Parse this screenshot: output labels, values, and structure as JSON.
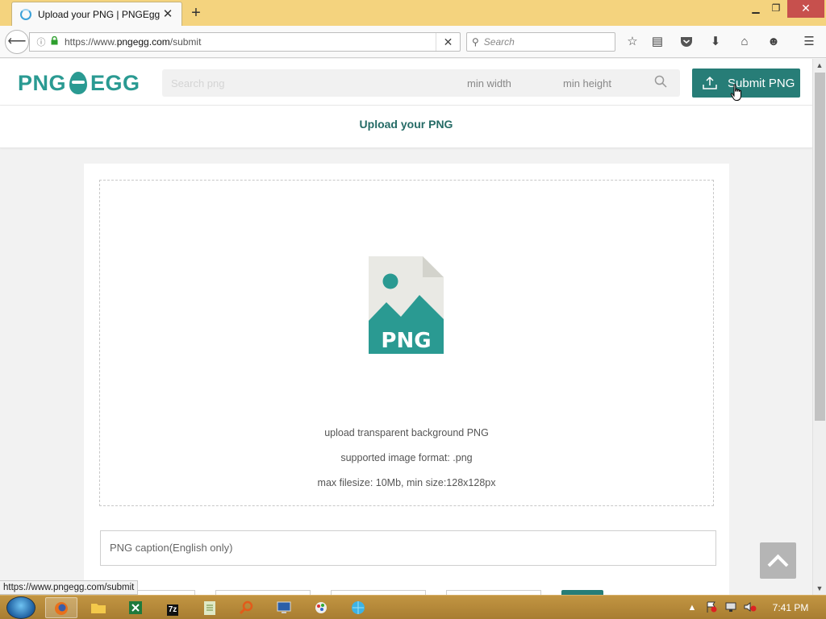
{
  "browser": {
    "tab_title": "Upload your PNG | PNGEgg",
    "url_prefix": "https://www.",
    "url_host": "pngegg.com",
    "url_path": "/submit",
    "search_placeholder": "Search",
    "status_url": "https://www.pngegg.com/submit"
  },
  "site": {
    "logo_left": "PNG",
    "logo_right": "EGG",
    "search_placeholder": "Search png",
    "min_width_label": "min width",
    "min_height_label": "min height",
    "submit_label": "Submit PNG"
  },
  "subnav": {
    "title": "Upload your PNG"
  },
  "upload": {
    "icon_label": "PNG",
    "line1": "upload transparent background PNG",
    "line2": "supported image format: .png",
    "line3": "max filesize: 10Mb, min size:128x128px"
  },
  "form": {
    "caption_placeholder": "PNG caption(English only)"
  },
  "taskbar": {
    "clock": "7:41 PM",
    "app_label_7z": "7z"
  },
  "colors": {
    "accent": "#2a9a92",
    "button": "#277d77",
    "titlebar": "#f4d37e"
  }
}
